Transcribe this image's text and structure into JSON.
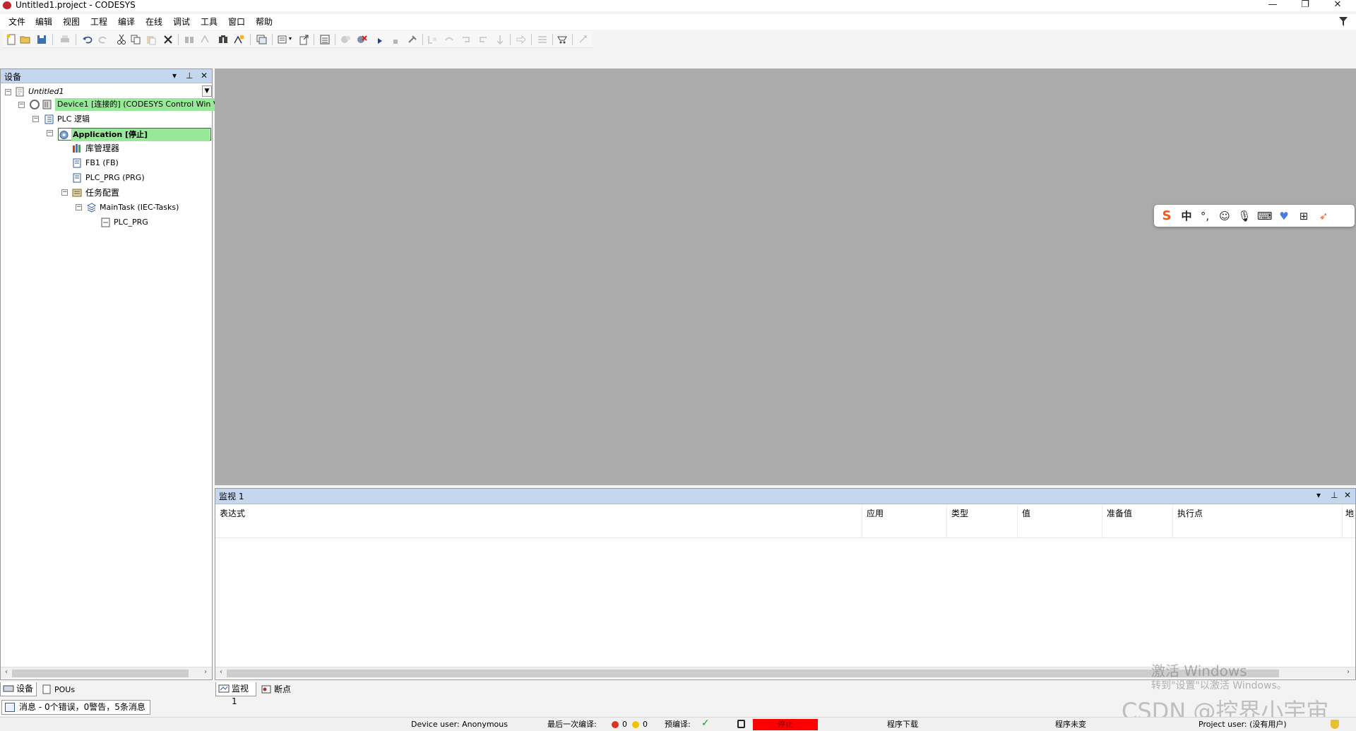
{
  "window": {
    "title": "Untitled1.project - CODESYS",
    "minimize": "—",
    "restore": "❐",
    "close": "✕"
  },
  "menu": [
    "文件",
    "编辑",
    "视图",
    "工程",
    "编译",
    "在线",
    "调试",
    "工具",
    "窗口",
    "帮助"
  ],
  "devices_panel": {
    "title": "设备",
    "tree": {
      "project": "Untitled1",
      "device": "Device1 [连接的] (CODESYS Control Win V3)",
      "plc_logic": "PLC 逻辑",
      "application": "Application [停止]",
      "library_manager": "库管理器",
      "fb1": "FB1 (FB)",
      "plc_prg": "PLC_PRG (PRG)",
      "task_config": "任务配置",
      "main_task": "MainTask (IEC-Tasks)",
      "task_plc_prg": "PLC_PRG"
    },
    "tabs": [
      "设备",
      "POUs"
    ]
  },
  "watch_panel": {
    "title": "监视 1",
    "columns": [
      "表达式",
      "应用",
      "类型",
      "值",
      "准备值",
      "执行点",
      "地"
    ],
    "tabs": [
      "监视 1",
      "断点"
    ]
  },
  "messages": {
    "summary": "消息 - 0个错误，0警告，5条消息"
  },
  "status": {
    "device_user": "Device user: Anonymous",
    "last_build_label": "最后一次编译:",
    "errors": "0",
    "warnings": "0",
    "precompile_label": "预编译:",
    "app_state": "停止",
    "program_download": "程序下载",
    "program_unchanged": "程序未变",
    "project_user": "Project user: (没有用户)"
  },
  "ime_toolbar": {
    "mode": "中"
  },
  "watermark": {
    "activate_line1": "激活 Windows",
    "activate_line2": "转到\"设置\"以激活 Windows。",
    "csdn": "CSDN @控界小宇宙"
  },
  "colors": {
    "panel_header": "#c5d7ef",
    "editor_bg": "#ababab",
    "online_green": "#98e89a",
    "stop_red": "#ff0000"
  }
}
